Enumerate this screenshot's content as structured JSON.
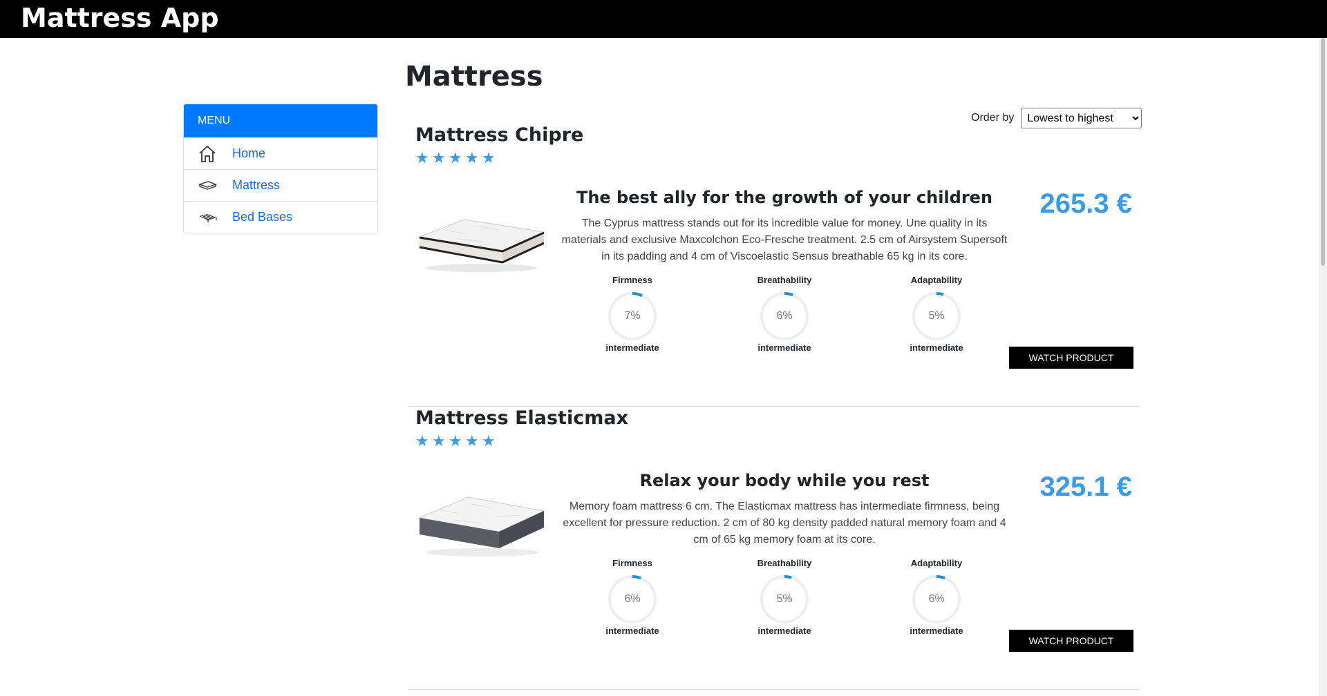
{
  "app": {
    "title": "Mattress App"
  },
  "sidebar": {
    "header": "MENU",
    "items": [
      {
        "label": "Home",
        "icon": "home-icon"
      },
      {
        "label": "Mattress",
        "icon": "mattress-icon"
      },
      {
        "label": "Bed Bases",
        "icon": "bed-base-icon"
      }
    ]
  },
  "page": {
    "title": "Mattress"
  },
  "order": {
    "label": "Order by",
    "selected": "Lowest to highest"
  },
  "products": [
    {
      "name": "Mattress Chipre",
      "rating": 5,
      "subtitle": "The best ally for the growth of your children",
      "description": "The Cyprus mattress stands out for its incredible value for money. Une quality in its materials and exclusive Maxcolchon Eco-Fresche treatment. 2.5 cm of Airsystem Supersoft in its padding and 4 cm of Viscoelastic Sensus breathable 65 kg in its core.",
      "price": "265.3 €",
      "button": "WATCH PRODUCT",
      "attributes": [
        {
          "label": "Firmness",
          "value": "7%",
          "percent": 7,
          "level": "intermediate"
        },
        {
          "label": "Breathability",
          "value": "6%",
          "percent": 6,
          "level": "intermediate"
        },
        {
          "label": "Adaptability",
          "value": "5%",
          "percent": 5,
          "level": "intermediate"
        }
      ]
    },
    {
      "name": "Mattress Elasticmax",
      "rating": 5,
      "subtitle": "Relax your body while you rest",
      "description": "Memory foam mattress 6 cm. The Elasticmax mattress has intermediate firmness, being excellent for pressure reduction. 2 cm of 80 kg density padded natural memory foam and 4 cm of 65 kg memory foam at its core.",
      "price": "325.1 €",
      "button": "WATCH PRODUCT",
      "attributes": [
        {
          "label": "Firmness",
          "value": "6%",
          "percent": 6,
          "level": "intermediate"
        },
        {
          "label": "Breathability",
          "value": "5%",
          "percent": 5,
          "level": "intermediate"
        },
        {
          "label": "Adaptability",
          "value": "6%",
          "percent": 6,
          "level": "intermediate"
        }
      ]
    }
  ],
  "colors": {
    "accent": "#3a9be8",
    "menu": "#007bff",
    "link": "#0d6efd"
  }
}
